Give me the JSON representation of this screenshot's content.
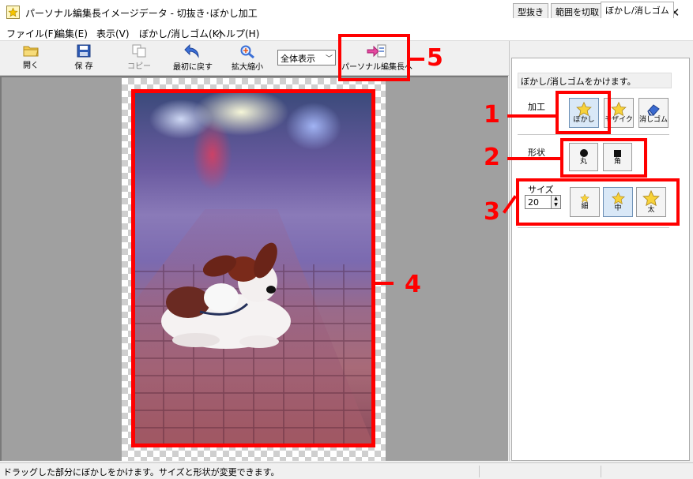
{
  "window": {
    "title": "パーソナル編集長イメージデータ - 切抜き･ぼかし加工",
    "minimize": "—",
    "maximize": "☐",
    "close": "✕"
  },
  "menu": [
    "ファイル(F)",
    "編集(E)",
    "表示(V)",
    "ぼかし/消しゴム(K)",
    "ヘルプ(H)"
  ],
  "toolbar": {
    "open": "開く",
    "save": "保 存",
    "copy": "コピー",
    "reset": "最初に戻す",
    "zoom": "拡大縮小",
    "view_select": "全体表示",
    "to_editor": "パーソナル編集長へ"
  },
  "panel": {
    "tabs": [
      "型抜き",
      "範囲を切取",
      "ぼかし/消しゴム"
    ],
    "active_tab": "ぼかし/消しゴム",
    "description": "ぼかし/消しゴムをかけます。",
    "process_label": "加工",
    "process_buttons": [
      "ぼかし",
      "モザイク",
      "消しゴム"
    ],
    "shape_label": "形状",
    "shape_buttons": [
      "丸",
      "角"
    ],
    "size_label": "サイズ",
    "size_value": "20",
    "size_buttons": [
      "細",
      "中",
      "太"
    ]
  },
  "annotations": [
    "1",
    "2",
    "3",
    "4",
    "5"
  ],
  "status": {
    "text": "ドラッグした部分にぼかしをかけます。サイズと形状が変更できます。"
  },
  "colors": {
    "annotation_red": "#ff0000",
    "selected_button": "#d9e8f7"
  }
}
